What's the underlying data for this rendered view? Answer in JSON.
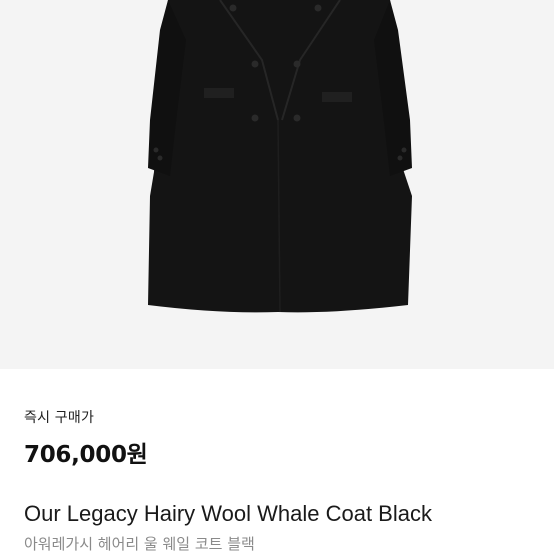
{
  "product": {
    "image_name": "black-double-breasted-wool-coat",
    "price_label": "즉시 구매가",
    "price": "706,000원",
    "title_en": "Our Legacy Hairy Wool Whale Coat Black",
    "title_ko": "아워레가시 헤어리 울 웨일 코트 블랙"
  },
  "colors": {
    "image_background": "#f4f4f4",
    "coat": "#141414",
    "button": "#2a2a2a",
    "price_text": "#111111",
    "subtitle_text": "#8a8a8a"
  }
}
